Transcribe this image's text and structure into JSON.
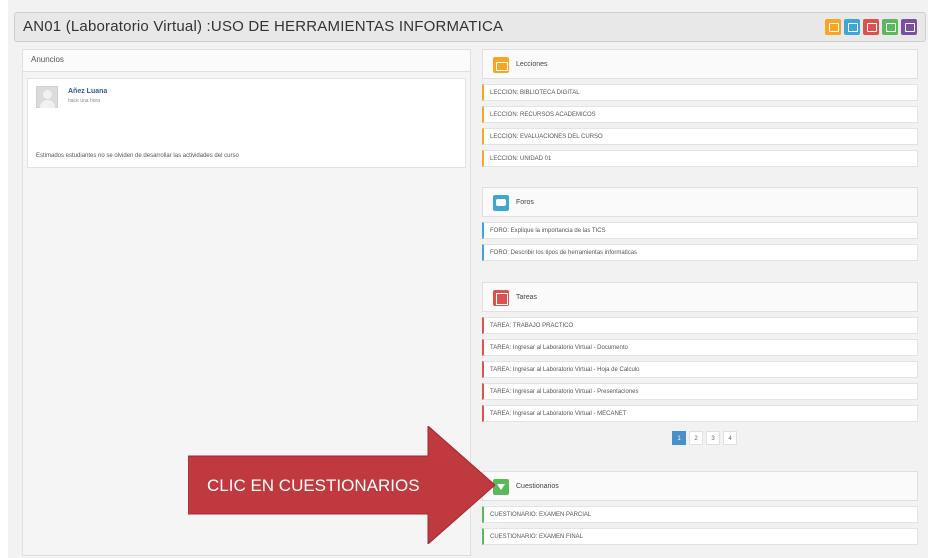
{
  "header": {
    "title": "AN01 (Laboratorio Virtual) :USO DE HERRAMIENTAS INFORMATICA",
    "icons": [
      {
        "name": "lessons-icon",
        "color": "#f5a623"
      },
      {
        "name": "forums-icon",
        "color": "#3fa7d6"
      },
      {
        "name": "tasks-icon",
        "color": "#d9534f"
      },
      {
        "name": "quiz-icon",
        "color": "#5cb85c"
      },
      {
        "name": "chat-icon",
        "color": "#7b4fa0"
      }
    ]
  },
  "announcements": {
    "title": "Anuncios",
    "post": {
      "author": "Añez Luana",
      "time": "hace una hora",
      "text": "Estimados estudiantes no se olviden de desarrollar las actividades del curso"
    }
  },
  "sections": {
    "lessons": {
      "title": "Lecciones",
      "color": "#f5a623",
      "items": [
        "LECCION: BIBLIOTECA DIGITAL",
        "LECCION: RECURSOS ACADEMICOS",
        "LECCION: EVALUACIONES DEL CURSO",
        "LECCION: UNIDAD 01"
      ]
    },
    "forums": {
      "title": "Foros",
      "color": "#3fa7d6",
      "items": [
        "FORO: Explique la importancia de las TICS",
        "FORO: Describir los tipos de herramientas informaticas"
      ]
    },
    "tasks": {
      "title": "Tareas",
      "color": "#d9534f",
      "items": [
        "TAREA: TRABAJO PRACTICO",
        "TAREA: Ingresar al Laboratorio Virtual - Documento",
        "TAREA: Ingresar al Laboratorio Virtual - Hoja de Calculo",
        "TAREA: Ingresar al Laboratorio Virtual - Presentaciones",
        "TAREA: Ingresar al Laboratorio Virtual - MECANET"
      ]
    },
    "quizzes": {
      "title": "Cuestionarios",
      "color": "#5cb85c",
      "items": [
        "CUESTIONARIO: EXAMEN PARCIAL",
        "CUESTIONARIO: EXAMEN FINAL"
      ]
    }
  },
  "pagination": [
    "1",
    "2",
    "3",
    "4"
  ],
  "callout": {
    "text": "CLIC EN CUESTIONARIOS",
    "color": "#c0393f"
  }
}
